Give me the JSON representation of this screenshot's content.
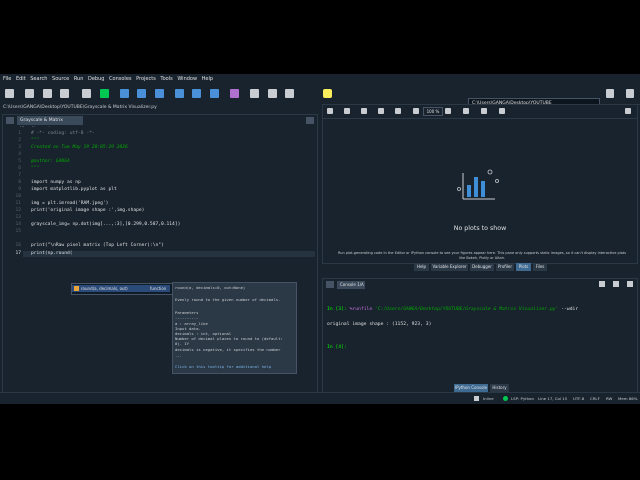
{
  "menu": [
    "File",
    "Edit",
    "Search",
    "Source",
    "Run",
    "Debug",
    "Consoles",
    "Projects",
    "Tools",
    "Window",
    "Help"
  ],
  "toolbar": {
    "path": "C:\\Users\\GANGA\\Desktop\\YOUTUBE",
    "path_icon": "folder-icon"
  },
  "editor": {
    "file_path": "C:\\Users\\GANGA\\Desktop\\YOUTUBE\\Grayscale & Matrix Visualizer.py",
    "tab_label": "Grayscale & Matrix Visualizer.py*",
    "lines": [
      {
        "n": "1",
        "text": "# -*- coding: utf-8 -*-"
      },
      {
        "n": "2",
        "text": "\"\"\""
      },
      {
        "n": "3",
        "text": "Created on Tue May 19 20:05:29 2026"
      },
      {
        "n": "4",
        "text": ""
      },
      {
        "n": "5",
        "text": "@author: GANGA"
      },
      {
        "n": "6",
        "text": "\"\"\""
      },
      {
        "n": "7",
        "text": ""
      },
      {
        "n": "8",
        "text": "import numpy as np"
      },
      {
        "n": "9",
        "text": "import matplotlib.pyplot as plt"
      },
      {
        "n": "10",
        "text": ""
      },
      {
        "n": "11",
        "text": "img = plt.imread('RAM.jpeg')"
      },
      {
        "n": "12",
        "text": "print('original image shape :',img.shape)"
      },
      {
        "n": "13",
        "text": ""
      },
      {
        "n": "14",
        "text": "grayscale_img= np.dot(img[...,:3],[0.299,0.587,0.114])"
      },
      {
        "n": "15",
        "text": ""
      },
      {
        "n": "16",
        "text": "print(\"\\nRaw pixel matrix (Top Left Corner):\\n\")"
      },
      {
        "n": "17",
        "text": "print(np.round("
      }
    ],
    "completion": {
      "item": "round(a, decimals, out)",
      "kind": "function"
    },
    "tooltip": [
      "round(a, decimals=0, out=None)",
      "",
      "Evenly round to the given number of decimals.",
      "",
      "Parameters",
      "----------",
      "a : array_like",
      "Input data.",
      "decimals : int, optional",
      "Number of decimal places to round to (default:",
      "0). If",
      "decimals is negative, it specifies the number",
      "...",
      "Click on this tooltip for additional help"
    ]
  },
  "plots": {
    "empty_title": "No plots to show",
    "hint": "Run plot-generating code in the Editor or IPython console to see your figures appear here. This pane only supports static images, so it can't display interactive plots like Bokeh, Plotly or Altair.",
    "zoom": "100 %",
    "tabs": [
      "Help",
      "Variable Explorer",
      "Debugger",
      "Profiler",
      "Plots",
      "Files"
    ],
    "active_tab": "Plots"
  },
  "console": {
    "tab_label": "Console 1/A",
    "in_prompt": "In [3]: ",
    "magic": "%runfile ",
    "path_arg": "'C:/Users/GANGA/Desktop/YOUTUBE/Grayscale & Matrix Visualizer.py'",
    "wdir": " --wdir",
    "output": "original image shape : (1152, 923, 3)",
    "next_prompt": "In [4]: ",
    "tabs": [
      "IPython Console",
      "History"
    ],
    "active_tab": "IPython Console"
  },
  "status": {
    "left": "Inline",
    "lsp": "LSP: Python",
    "pos": "Line 17, Col 15",
    "enc": "UTF-8",
    "eol": "CRLF",
    "rw": "RW",
    "mem": "Mem 86%"
  },
  "colors": {
    "accent": "#3f6b93",
    "background": "#19232d"
  }
}
